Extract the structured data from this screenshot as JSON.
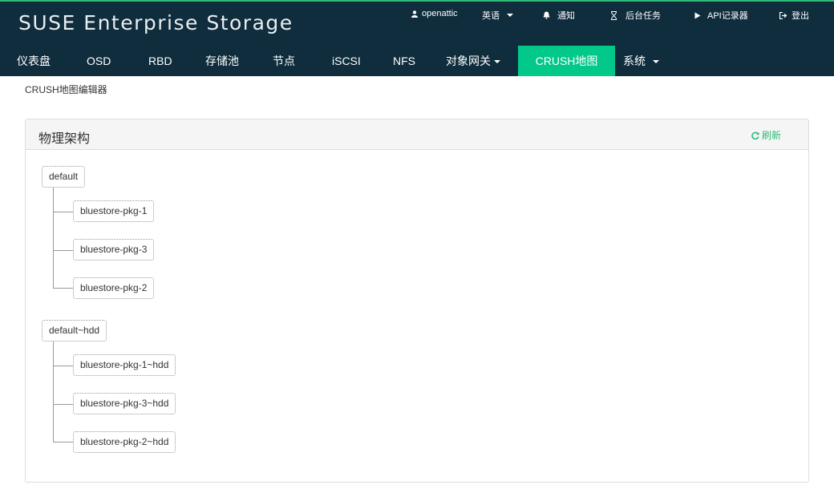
{
  "app": {
    "brand": "SUSE Enterprise Storage"
  },
  "topnav": {
    "user": "openattic",
    "language": "英语",
    "notifications": "通知",
    "tasks": "后台任务",
    "api_recorder": "API记录器",
    "logout": "登出"
  },
  "menu": {
    "items": [
      "仪表盘",
      "OSD",
      "RBD",
      "存储池",
      "节点",
      "iSCSI",
      "NFS",
      "对象网关",
      "CRUSH地图",
      "系统"
    ],
    "active": "CRUSH地图"
  },
  "breadcrumb": "CRUSH地图编辑器",
  "panel": {
    "title": "物理架构",
    "refresh_label": "刷新"
  },
  "tree": [
    {
      "root": "default",
      "children": [
        "bluestore-pkg-1",
        "bluestore-pkg-3",
        "bluestore-pkg-2"
      ]
    },
    {
      "root": "default~hdd",
      "children": [
        "bluestore-pkg-1~hdd",
        "bluestore-pkg-3~hdd",
        "bluestore-pkg-2~hdd"
      ]
    }
  ],
  "colors": {
    "header_bg": "#0f2d3d",
    "accent": "#02c88a",
    "refresh": "#30ba78"
  }
}
